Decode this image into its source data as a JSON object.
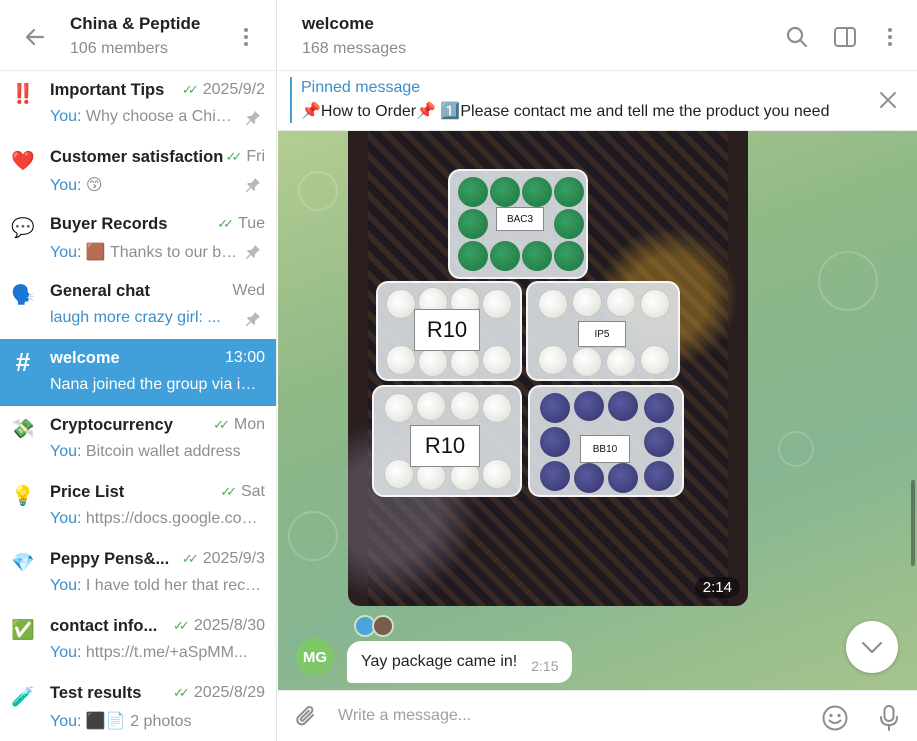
{
  "group": {
    "title": "China & Peptide",
    "members": "106 members"
  },
  "topics": [
    {
      "icon": "‼️",
      "icon_name": "double-exclamation-icon",
      "name": "Important Tips",
      "date": "2025/9/2",
      "checks": true,
      "sender": "You:",
      "preview": "Why choose a Chinese supplier",
      "pinned": true,
      "active": false
    },
    {
      "icon": "❤️",
      "icon_name": "heart-icon",
      "name": "Customer satisfaction",
      "date": "Fri",
      "checks": true,
      "sender": "You:",
      "preview": "😙",
      "pinned": true,
      "active": false
    },
    {
      "icon": "💬",
      "icon_name": "speech-bubble-icon",
      "name": "Buyer Records",
      "date": "Tue",
      "checks": true,
      "sender": "You:",
      "preview": "🟫 Thanks to our buyers",
      "pinned": true,
      "active": false
    },
    {
      "icon": "🗣️",
      "icon_name": "speaking-head-icon",
      "name": "General chat",
      "date": "Wed",
      "checks": false,
      "sender": "",
      "preview": "laugh more crazy girl: ...",
      "preview_link": true,
      "pinned": true,
      "active": false
    },
    {
      "icon": "#",
      "icon_name": "hashtag-icon",
      "name": "welcome",
      "date": "13:00",
      "checks": false,
      "sender": "",
      "preview": "Nana joined the group via invite link",
      "pinned": false,
      "active": true
    },
    {
      "icon": "💸",
      "icon_name": "money-wings-icon",
      "name": "Cryptocurrency",
      "date": "Mon",
      "checks": true,
      "sender": "You:",
      "preview": "Bitcoin wallet address",
      "pinned": false,
      "active": false
    },
    {
      "icon": "💡",
      "icon_name": "light-bulb-icon",
      "name": "Price List",
      "date": "Sat",
      "checks": true,
      "sender": "You:",
      "preview": "https://docs.google.com/spreadsheets",
      "pinned": false,
      "active": false
    },
    {
      "icon": "💎",
      "icon_name": "gem-icon",
      "name": "Peppy Pens&amp;...",
      "date": "2025/9/3",
      "checks": true,
      "sender": "You:",
      "preview": "I have told her that received",
      "pinned": false,
      "active": false
    },
    {
      "icon": "✅",
      "icon_name": "check-mark-icon",
      "name": "contact info...",
      "date": "2025/8/30",
      "checks": true,
      "sender": "You:",
      "preview": "https://t.me/+aSpMM...",
      "pinned": false,
      "active": false
    },
    {
      "icon": "🧪",
      "icon_name": "test-tube-icon",
      "name": "Test results",
      "date": "2025/8/29",
      "checks": true,
      "sender": "You:",
      "preview": "⬛📄 2 photos",
      "pinned": false,
      "active": false
    }
  ],
  "chat": {
    "title": "welcome",
    "messages_count": "168 messages"
  },
  "pinned": {
    "label": "Pinned message",
    "text": "📌How to Order📌 1️⃣Please contact me and tell me the product you need"
  },
  "photo": {
    "time": "2:14",
    "labels": {
      "top": "BAC3",
      "mid_left": "R10",
      "mid_right": "IP5",
      "bot_left": "R10",
      "bot_right": "BB10"
    }
  },
  "message": {
    "avatar_initials": "MG",
    "text": "Yay package came in!",
    "time": "2:15"
  },
  "composer": {
    "placeholder": "Write a message..."
  },
  "colors": {
    "accent": "#419fd9",
    "check_green": "#4fae4e",
    "link_blue": "#3a8fcc",
    "avatar_green": "#7ec86a"
  }
}
